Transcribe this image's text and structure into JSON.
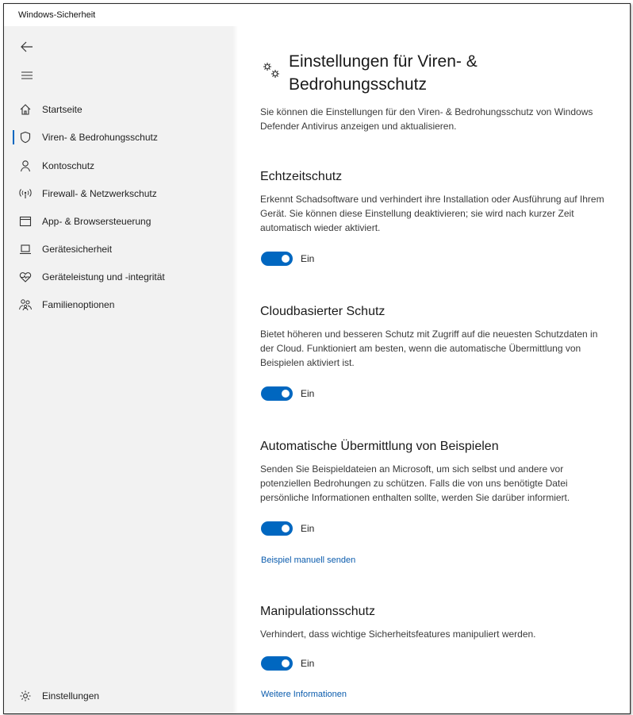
{
  "window": {
    "title": "Windows-Sicherheit"
  },
  "sidebar": {
    "items": [
      {
        "label": "Startseite",
        "icon": "home-icon"
      },
      {
        "label": "Viren- & Bedrohungsschutz",
        "icon": "shield-icon",
        "selected": true
      },
      {
        "label": "Kontoschutz",
        "icon": "person-icon"
      },
      {
        "label": "Firewall- & Netzwerkschutz",
        "icon": "wireless-icon"
      },
      {
        "label": "App- & Browsersteuerung",
        "icon": "browser-window-icon"
      },
      {
        "label": "Gerätesicherheit",
        "icon": "laptop-icon"
      },
      {
        "label": "Geräteleistung und -integrität",
        "icon": "heart-pulse-icon"
      },
      {
        "label": "Familienoptionen",
        "icon": "family-icon"
      }
    ],
    "settings_label": "Einstellungen"
  },
  "main": {
    "title": "Einstellungen für Viren- & Bedrohungsschutz",
    "description": "Sie können die Einstellungen für den Viren- & Bedrohungsschutz von Windows Defender Antivirus anzeigen und aktualisieren.",
    "sections": [
      {
        "title": "Echtzeitschutz",
        "description": "Erkennt Schadsoftware und verhindert ihre Installation oder Ausführung auf Ihrem Gerät. Sie können diese Einstellung deaktivieren; sie wird nach kurzer Zeit automatisch wieder aktiviert.",
        "toggle_state": "Ein",
        "toggle_on": true
      },
      {
        "title": "Cloudbasierter Schutz",
        "description": "Bietet höheren und besseren Schutz mit Zugriff auf die neuesten Schutzdaten in der Cloud. Funktioniert am besten, wenn die automatische Übermittlung von Beispielen aktiviert ist.",
        "toggle_state": "Ein",
        "toggle_on": true
      },
      {
        "title": "Automatische Übermittlung von Beispielen",
        "description": "Senden Sie Beispieldateien an Microsoft, um sich selbst und andere vor potenziellen Bedrohungen zu schützen. Falls die von uns benötigte Datei persönliche Informationen enthalten sollte, werden Sie darüber informiert.",
        "toggle_state": "Ein",
        "toggle_on": true,
        "link": "Beispiel manuell senden"
      },
      {
        "title": "Manipulationsschutz",
        "description": "Verhindert, dass wichtige Sicherheitsfeatures manipuliert werden.",
        "toggle_state": "Ein",
        "toggle_on": true,
        "link": "Weitere Informationen"
      }
    ]
  },
  "colors": {
    "accent": "#0067c0",
    "link": "#0b5cad",
    "sidebar_bg": "#f2f2f2"
  }
}
